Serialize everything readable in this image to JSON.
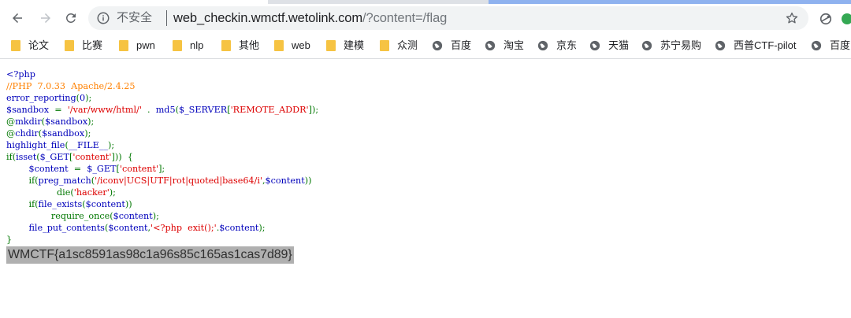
{
  "browser": {
    "security_label": "不安全",
    "url_host": "web_checkin.wmctf.wetolink.com",
    "url_rest": "/?content=/flag"
  },
  "bookmarks": [
    {
      "label": "论文",
      "icon": "folder-icon"
    },
    {
      "label": "比赛",
      "icon": "folder-icon"
    },
    {
      "label": "pwn",
      "icon": "folder-icon"
    },
    {
      "label": "nlp",
      "icon": "folder-icon"
    },
    {
      "label": "其他",
      "icon": "folder-icon"
    },
    {
      "label": "web",
      "icon": "folder-icon"
    },
    {
      "label": "建模",
      "icon": "folder-icon"
    },
    {
      "label": "众测",
      "icon": "folder-icon"
    },
    {
      "label": "百度",
      "icon": "globe-icon"
    },
    {
      "label": "淘宝",
      "icon": "globe-icon"
    },
    {
      "label": "京东",
      "icon": "globe-icon"
    },
    {
      "label": "天猫",
      "icon": "globe-icon"
    },
    {
      "label": "苏宁易购",
      "icon": "globe-icon"
    },
    {
      "label": "西普CTF-pilot",
      "icon": "globe-icon"
    },
    {
      "label": "百度",
      "icon": "globe-icon"
    }
  ],
  "source": {
    "l01": "<?php",
    "l02": "//PHP  7.0.33  Apache/2.4.25",
    "l03a": "error_reporting",
    "l03b": "(",
    "l03c": "0",
    "l03d": ");",
    "l04a": "$sandbox  ",
    "l04b": "=  ",
    "l04c": "'/var/www/html/'",
    "l04d": "  .  ",
    "l04e": "md5",
    "l04f": "(",
    "l04g": "$_SERVER",
    "l04h": "[",
    "l04i": "'REMOTE_ADDR'",
    "l04j": "]);",
    "l05a": "@",
    "l05b": "mkdir",
    "l05c": "(",
    "l05d": "$sandbox",
    "l05e": ");",
    "l06a": "@",
    "l06b": "chdir",
    "l06c": "(",
    "l06d": "$sandbox",
    "l06e": ");",
    "l07a": "highlight_file",
    "l07b": "(",
    "l07c": "__FILE__",
    "l07d": ");",
    "l08a": "if(",
    "l08b": "isset",
    "l08c": "(",
    "l08d": "$_GET",
    "l08e": "[",
    "l08f": "'content'",
    "l08g": "]))  {",
    "l09a": "        $content  ",
    "l09b": "=  ",
    "l09c": "$_GET",
    "l09d": "[",
    "l09e": "'content'",
    "l09f": "];",
    "l10a": "        if(",
    "l10b": "preg_match",
    "l10c": "(",
    "l10d": "'/iconv|UCS|UTF|rot|quoted|base64/i'",
    "l10e": ",",
    "l10f": "$content",
    "l10g": "))",
    "l11a": "                  die",
    "l11b": "(",
    "l11c": "'hacker'",
    "l11d": ");",
    "l12a": "        if(",
    "l12b": "file_exists",
    "l12c": "(",
    "l12d": "$content",
    "l12e": "))",
    "l13a": "                require_once",
    "l13b": "(",
    "l13c": "$content",
    "l13d": ");",
    "l14a": "        file_put_contents",
    "l14b": "(",
    "l14c": "$content",
    "l14d": ",",
    "l14e": "'<?php  exit();'",
    "l14f": ".",
    "l14g": "$content",
    "l14h": ");",
    "l15": "}"
  },
  "output": {
    "flag": "WMCTF{a1sc8591as98c1a96s85c165as1cas7d89}"
  },
  "colors": {
    "php_default": "#0000bb",
    "php_comment": "#ff8000",
    "php_string": "#dd0000",
    "php_keyword": "#007700",
    "flag_highlight": "#b0b0b0"
  }
}
